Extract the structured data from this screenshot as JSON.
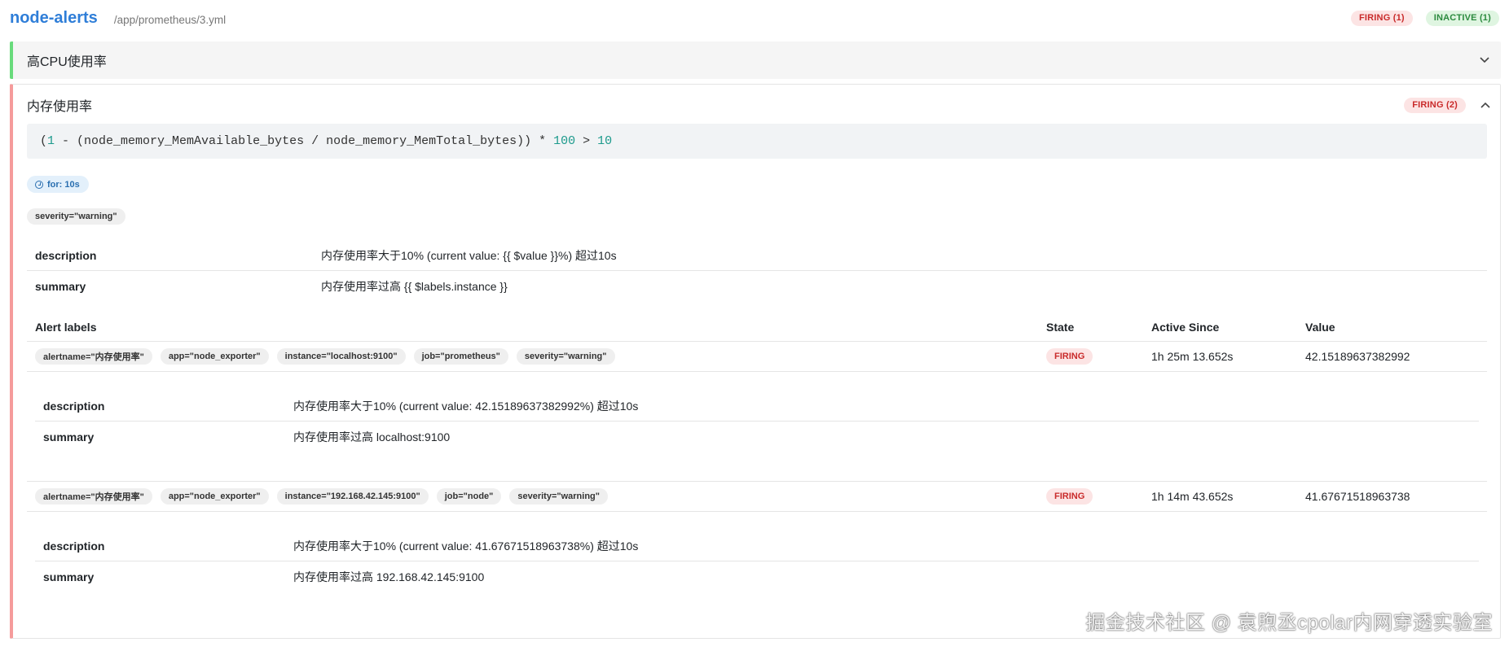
{
  "group": {
    "name": "node-alerts",
    "file": "/app/prometheus/3.yml",
    "badge_firing": "FIRING (1)",
    "badge_inactive": "INACTIVE (1)"
  },
  "rule1": {
    "title": "高CPU使用率"
  },
  "rule2": {
    "title": "内存使用率",
    "badge": "FIRING (2)",
    "expr_open": "(",
    "expr_num1": "1",
    "expr_mid": " - (node_memory_MemAvailable_bytes / node_memory_MemTotal_bytes)) * ",
    "expr_num2": "100",
    "expr_gt": " > ",
    "expr_num3": "10",
    "for": "for: 10s",
    "severity_label": "severity=\"warning\"",
    "annotations": [
      {
        "key": "description",
        "value": "内存使用率大于10% (current value: {{ $value }}%) 超过10s"
      },
      {
        "key": "summary",
        "value": "内存使用率过高 {{ $labels.instance }}"
      }
    ],
    "table_headers": {
      "labels": "Alert labels",
      "state": "State",
      "since": "Active Since",
      "value": "Value"
    },
    "alerts": [
      {
        "labels": [
          "alertname=\"内存使用率\"",
          "app=\"node_exporter\"",
          "instance=\"localhost:9100\"",
          "job=\"prometheus\"",
          "severity=\"warning\""
        ],
        "state": "FIRING",
        "since": "1h 25m 13.652s",
        "value": "42.15189637382992",
        "annotations": [
          {
            "key": "description",
            "value": "内存使用率大于10% (current value: 42.15189637382992%) 超过10s"
          },
          {
            "key": "summary",
            "value": "内存使用率过高 localhost:9100"
          }
        ]
      },
      {
        "labels": [
          "alertname=\"内存使用率\"",
          "app=\"node_exporter\"",
          "instance=\"192.168.42.145:9100\"",
          "job=\"node\"",
          "severity=\"warning\""
        ],
        "state": "FIRING",
        "since": "1h 14m 43.652s",
        "value": "41.67671518963738",
        "annotations": [
          {
            "key": "description",
            "value": "内存使用率大于10% (current value: 41.67671518963738%) 超过10s"
          },
          {
            "key": "summary",
            "value": "内存使用率过高 192.168.42.145:9100"
          }
        ]
      }
    ]
  },
  "watermark": "掘金技术社区 @ 袁煦丞cpolar内网穿透实验室",
  "colors": {
    "accent": "#2f7ed8",
    "firing": "#c92a2a",
    "inactive": "#2b8a3e",
    "rule1_border": "#69db7c",
    "rule2_border": "#f59b9b"
  }
}
